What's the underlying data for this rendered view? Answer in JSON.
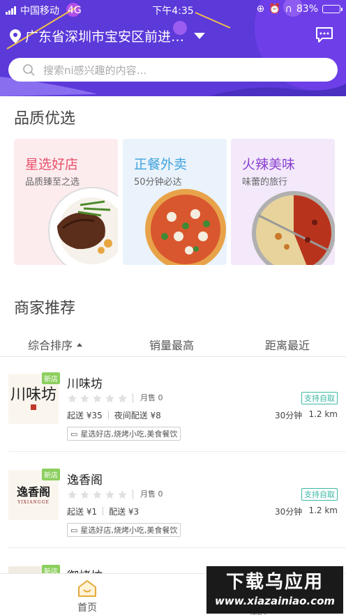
{
  "status_bar": {
    "carrier": "中国移动",
    "network": "4G",
    "time": "下午4:35",
    "battery": "83%",
    "battery_level": 0.83
  },
  "header": {
    "location": "广东省深圳市宝安区前进…",
    "search_placeholder": "搜索ni感兴趣的内容..."
  },
  "quality": {
    "title": "品质优选",
    "cards": [
      {
        "title": "星选好店",
        "subtitle": "品质臻至之选",
        "color": "#e8506a",
        "bg": "#fdecee"
      },
      {
        "title": "正餐外卖",
        "subtitle": "50分钟必达",
        "color": "#3fa2de",
        "bg": "#eaf3fb"
      },
      {
        "title": "火辣美味",
        "subtitle": "味蕾的旅行",
        "color": "#8a3fd0",
        "bg": "#f3e9fb"
      }
    ]
  },
  "merchants": {
    "title": "商家推荐",
    "sort": [
      "综合排序",
      "销量最高",
      "距离最近"
    ],
    "shops": [
      {
        "name": "川味坊",
        "badge": "新店",
        "logo_text": "川味坊",
        "rating": 0,
        "sold": "月售 0",
        "pickup": "支持自取",
        "min_order": "起送 ¥35",
        "delivery": "夜间配送 ¥8",
        "time": "30分钟",
        "distance": "1.2 km",
        "tags": "星选好店,烧烤小吃,美食餐饮"
      },
      {
        "name": "逸香阁",
        "badge": "新店",
        "logo_text": "逸香阁",
        "logo_sub": "YIXIANGGE",
        "rating": 0,
        "sold": "月售 0",
        "pickup": "支持自取",
        "min_order": "起送 ¥1",
        "delivery": "配送 ¥3",
        "time": "30分钟",
        "distance": "1.2 km",
        "tags": "星选好店,烧烤小吃,美食餐饮"
      },
      {
        "name": "御烤坊",
        "badge": "新店"
      }
    ]
  },
  "tabbar": {
    "home": "首页",
    "other": "我的"
  },
  "watermark": {
    "title": "下载乌应用",
    "url": "www.xiazainiao.com"
  }
}
